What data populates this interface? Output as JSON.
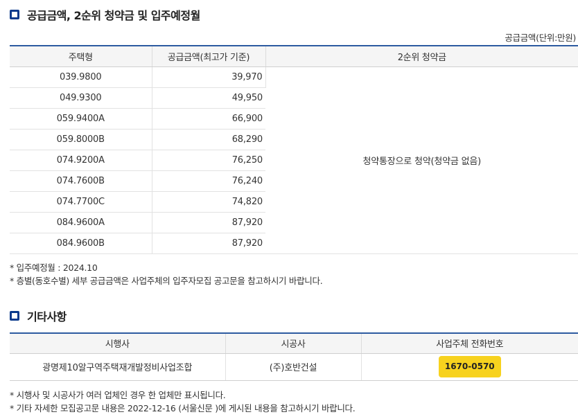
{
  "section1": {
    "title": "공급금액, 2순위 청약금 및 입주예정월",
    "unit": "공급금액(단위:만원)"
  },
  "supply_table": {
    "headers": [
      "주택형",
      "공급금액(최고가 기준)",
      "2순위 청약금"
    ],
    "merged_note": "청약통장으로 청약(청약금 없음)",
    "rows": [
      {
        "type": "039.9800",
        "price": "39,970"
      },
      {
        "type": "049.9300",
        "price": "49,950"
      },
      {
        "type": "059.9400A",
        "price": "66,900"
      },
      {
        "type": "059.8000B",
        "price": "68,290"
      },
      {
        "type": "074.9200A",
        "price": "76,250"
      },
      {
        "type": "074.7600B",
        "price": "76,240"
      },
      {
        "type": "074.7700C",
        "price": "74,820"
      },
      {
        "type": "084.9600A",
        "price": "87,920"
      },
      {
        "type": "084.9600B",
        "price": "87,920"
      }
    ]
  },
  "notes1": [
    "* 입주예정월 : 2024.10",
    "* 층별(동호수별) 세부 공급금액은 사업주체의 입주자모집 공고문을 참고하시기 바랍니다."
  ],
  "section2": {
    "title": "기타사항"
  },
  "etc_table": {
    "headers": [
      "시행사",
      "시공사",
      "사업주체 전화번호"
    ],
    "developer": "광명제10알구역주택재개발정비사업조합",
    "builder": "(주)호반건설",
    "phone": "1670-0570"
  },
  "notes2": [
    "* 시행사 및 시공사가 여러 업체인 경우 한 업체만 표시됩니다.",
    "* 기타 자세한 모집공고문 내용은 2022-12-16 (서울신문 )에 게시된 내용을 참고하시기 바랍니다."
  ],
  "colors": {
    "accent": "#0a3a8c",
    "table_border": "#2c5aa0",
    "badge": "#f7d21e"
  }
}
